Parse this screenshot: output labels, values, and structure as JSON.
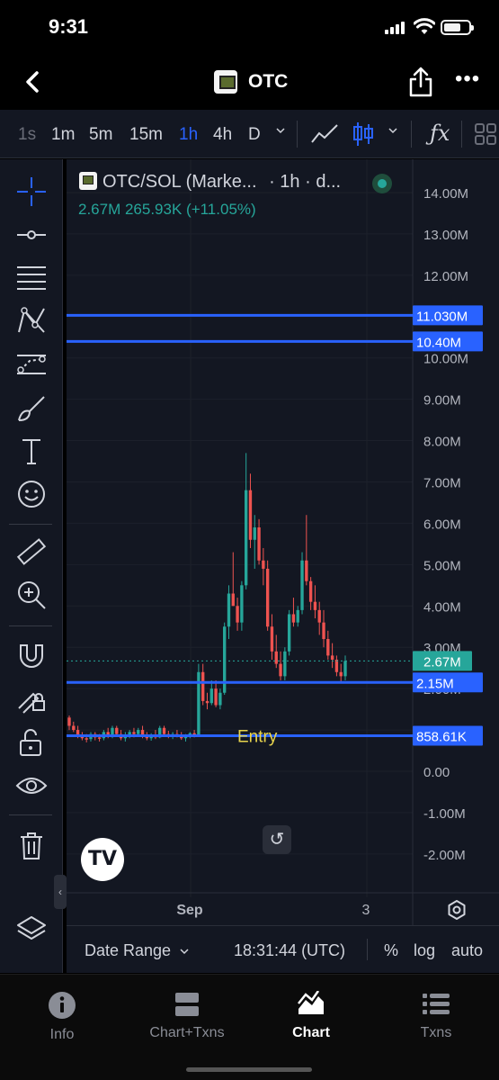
{
  "status_bar": {
    "time": "9:31"
  },
  "header": {
    "title": "OTC"
  },
  "interval_toolbar": {
    "intervals": [
      "1s",
      "1m",
      "5m",
      "15m",
      "1h",
      "4h",
      "D"
    ],
    "active_interval": "1h",
    "indicator_icon": "ƒx"
  },
  "chart": {
    "legend_symbol": "OTC/SOL (Marke...",
    "legend_interval": "· 1h · d...",
    "legend_values": "2.67M  265.93K (+11.05%)",
    "tv_logo": "TV",
    "reset_icon": "↺",
    "up_color": "#26a69a",
    "down_color": "#ef5350",
    "line_color": "#2962ff",
    "entry_label": "Entry",
    "x_labels": [
      "Sep",
      "3"
    ]
  },
  "chart_data": {
    "type": "candlestick",
    "title": "OTC/SOL (Marke...",
    "y_axis_labels": [
      "14.00M",
      "13.00M",
      "12.00M",
      "11.00M",
      "10.00M",
      "9.00M",
      "8.00M",
      "7.00M",
      "6.00M",
      "5.00M",
      "4.00M",
      "3.00M",
      "2.00M",
      "1.00M",
      "0.00",
      "-1.00M",
      "-2.00M"
    ],
    "ylim": [
      -2.4,
      14.4
    ],
    "x_tick_labels": [
      "Sep",
      "3"
    ],
    "last_price": "2.67M",
    "last_price_value": 2.67,
    "horizontal_lines": [
      {
        "value": 11.03,
        "label": "11.030M"
      },
      {
        "value": 10.4,
        "label": "10.40M"
      },
      {
        "value": 2.15,
        "label": "2.15M"
      },
      {
        "value": 0.859,
        "label": "858.61K",
        "annotation": "Entry"
      }
    ],
    "candles": [
      [
        1.3,
        1.35,
        1.0,
        1.1
      ],
      [
        1.1,
        1.2,
        0.95,
        1.0
      ],
      [
        1.0,
        1.1,
        0.8,
        0.85
      ],
      [
        0.85,
        0.95,
        0.75,
        0.8
      ],
      [
        0.8,
        0.9,
        0.7,
        0.78
      ],
      [
        0.78,
        0.95,
        0.72,
        0.9
      ],
      [
        0.9,
        0.95,
        0.75,
        0.82
      ],
      [
        0.82,
        0.9,
        0.72,
        0.8
      ],
      [
        0.8,
        1.0,
        0.75,
        0.95
      ],
      [
        0.95,
        1.05,
        0.8,
        0.85
      ],
      [
        0.85,
        1.1,
        0.8,
        1.05
      ],
      [
        1.05,
        1.1,
        0.85,
        0.9
      ],
      [
        0.9,
        1.0,
        0.75,
        0.8
      ],
      [
        0.8,
        0.95,
        0.72,
        0.88
      ],
      [
        0.88,
        1.0,
        0.8,
        0.95
      ],
      [
        0.95,
        1.05,
        0.82,
        0.9
      ],
      [
        0.9,
        1.05,
        0.85,
        1.0
      ],
      [
        1.0,
        1.1,
        0.8,
        0.85
      ],
      [
        0.85,
        0.95,
        0.75,
        0.8
      ],
      [
        0.8,
        0.92,
        0.74,
        0.88
      ],
      [
        0.88,
        1.0,
        0.78,
        0.82
      ],
      [
        0.82,
        1.1,
        0.8,
        1.05
      ],
      [
        1.05,
        1.1,
        0.85,
        0.9
      ],
      [
        0.9,
        0.98,
        0.8,
        0.85
      ],
      [
        0.85,
        0.95,
        0.78,
        0.9
      ],
      [
        0.9,
        1.0,
        0.82,
        0.86
      ],
      [
        0.86,
        0.95,
        0.76,
        0.8
      ],
      [
        0.8,
        0.9,
        0.72,
        0.85
      ],
      [
        0.85,
        0.95,
        0.8,
        0.92
      ],
      [
        0.92,
        1.0,
        0.82,
        0.88
      ],
      [
        0.88,
        2.6,
        0.85,
        2.4
      ],
      [
        2.4,
        2.6,
        1.6,
        1.7
      ],
      [
        1.7,
        1.9,
        1.5,
        1.65
      ],
      [
        1.65,
        2.2,
        1.6,
        2.0
      ],
      [
        2.0,
        2.2,
        1.55,
        1.6
      ],
      [
        1.6,
        2.0,
        1.5,
        1.9
      ],
      [
        1.9,
        3.6,
        1.85,
        3.5
      ],
      [
        3.5,
        4.5,
        3.2,
        4.3
      ],
      [
        4.3,
        5.3,
        4.0,
        4.0
      ],
      [
        4.0,
        4.2,
        3.4,
        3.6
      ],
      [
        3.6,
        4.6,
        3.4,
        4.5
      ],
      [
        4.5,
        7.7,
        4.4,
        6.8
      ],
      [
        6.8,
        7.2,
        5.4,
        5.6
      ],
      [
        5.6,
        6.2,
        4.9,
        5.9
      ],
      [
        5.9,
        6.1,
        5.0,
        5.1
      ],
      [
        5.1,
        5.4,
        4.5,
        4.9
      ],
      [
        4.9,
        5.1,
        3.4,
        3.5
      ],
      [
        3.5,
        3.8,
        2.7,
        2.9
      ],
      [
        2.9,
        3.3,
        2.5,
        2.6
      ],
      [
        2.6,
        2.9,
        2.2,
        2.3
      ],
      [
        2.3,
        3.0,
        2.2,
        2.9
      ],
      [
        2.9,
        3.9,
        2.8,
        3.8
      ],
      [
        3.8,
        4.2,
        3.5,
        3.6
      ],
      [
        3.6,
        4.0,
        3.5,
        3.9
      ],
      [
        3.9,
        5.3,
        3.8,
        5.1
      ],
      [
        5.1,
        6.2,
        4.5,
        4.6
      ],
      [
        4.6,
        4.7,
        3.9,
        4.1
      ],
      [
        4.1,
        4.5,
        3.7,
        3.9
      ],
      [
        3.9,
        4.1,
        3.3,
        3.6
      ],
      [
        3.6,
        3.9,
        3.0,
        3.2
      ],
      [
        3.2,
        3.4,
        2.7,
        2.8
      ],
      [
        2.8,
        3.1,
        2.5,
        2.7
      ],
      [
        2.7,
        2.8,
        2.3,
        2.4
      ],
      [
        2.4,
        2.6,
        2.15,
        2.3
      ],
      [
        2.3,
        2.8,
        2.2,
        2.67
      ]
    ]
  },
  "chart_bottom_bar": {
    "date_range_label": "Date Range",
    "utc_time": "18:31:44 (UTC)",
    "percent_label": "%",
    "log_label": "log",
    "auto_label": "auto"
  },
  "tab_bar": {
    "tabs": [
      {
        "label": "Info",
        "icon": "info-icon"
      },
      {
        "label": "Chart+Txns",
        "icon": "split-view-icon"
      },
      {
        "label": "Chart",
        "icon": "chart-icon"
      },
      {
        "label": "Txns",
        "icon": "list-icon"
      }
    ],
    "active_tab": "Chart"
  }
}
